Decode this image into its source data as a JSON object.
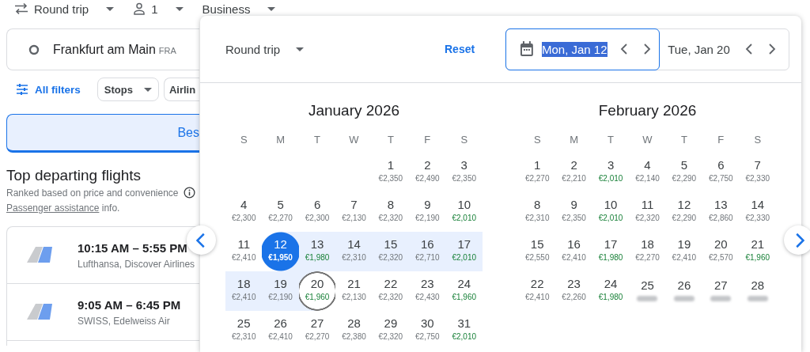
{
  "top_bar": {
    "trip_type": "Round trip",
    "passengers": "1",
    "cabin": "Business"
  },
  "search": {
    "origin": "Frankfurt am Main",
    "origin_code": "FRA"
  },
  "filters": {
    "all_filters": "All filters",
    "chips": [
      {
        "label": "Stops",
        "dropdown": true
      },
      {
        "label": "Airlin",
        "dropdown": false
      }
    ]
  },
  "sort_tab": {
    "label": "Bes",
    "selected": true
  },
  "results": {
    "title": "Top departing flights",
    "subtitle": "Ranked based on price and convenience",
    "link": "Passenger assistance",
    "link_suffix": " info."
  },
  "flights": [
    {
      "times": "10:15 AM – 5:55 PM",
      "airlines": "Lufthansa, Discover Airlines"
    },
    {
      "times": "9:05 AM – 6:45 PM",
      "airlines": "SWISS, Edelweiss Air"
    }
  ],
  "date_picker": {
    "trip_type": "Round trip",
    "reset": "Reset",
    "departure": {
      "value": "Mon, Jan 12",
      "focused": true,
      "text_selected": true
    },
    "return": {
      "value": "Tue, Jan 20",
      "focused": false,
      "text_selected": false
    },
    "months": [
      {
        "title": "January 2026",
        "weekdays": [
          "S",
          "M",
          "T",
          "W",
          "T",
          "F",
          "S"
        ],
        "weeks": [
          {
            "days": [
              {
                "kind": "blank"
              },
              {
                "kind": "blank"
              },
              {
                "kind": "blank"
              },
              {
                "kind": "blank"
              },
              {
                "kind": "day",
                "day": "1",
                "price": "€2,350",
                "low": false,
                "in_range": false
              },
              {
                "kind": "day",
                "day": "2",
                "price": "€2,490",
                "low": false,
                "in_range": false
              },
              {
                "kind": "day",
                "day": "3",
                "price": "€2,350",
                "low": false,
                "in_range": false
              }
            ]
          },
          {
            "days": [
              {
                "kind": "day",
                "day": "4",
                "price": "€2,300",
                "low": false,
                "in_range": false
              },
              {
                "kind": "day",
                "day": "5",
                "price": "€2,270",
                "low": false,
                "in_range": false
              },
              {
                "kind": "day",
                "day": "6",
                "price": "€2,300",
                "low": false,
                "in_range": false
              },
              {
                "kind": "day",
                "day": "7",
                "price": "€2,130",
                "low": false,
                "in_range": false
              },
              {
                "kind": "day",
                "day": "8",
                "price": "€2,320",
                "low": false,
                "in_range": false
              },
              {
                "kind": "day",
                "day": "9",
                "price": "€2,190",
                "low": false,
                "in_range": false
              },
              {
                "kind": "day",
                "day": "10",
                "price": "€2,010",
                "low": true,
                "in_range": false
              }
            ]
          },
          {
            "days": [
              {
                "kind": "day",
                "day": "11",
                "price": "€2,410",
                "low": false,
                "in_range": false
              },
              {
                "kind": "departure",
                "day": "12",
                "price": "€1,950"
              },
              {
                "kind": "day",
                "day": "13",
                "price": "€1,980",
                "low": true,
                "in_range": true
              },
              {
                "kind": "day",
                "day": "14",
                "price": "€2,310",
                "low": false,
                "in_range": true
              },
              {
                "kind": "day",
                "day": "15",
                "price": "€2,320",
                "low": false,
                "in_range": true
              },
              {
                "kind": "day",
                "day": "16",
                "price": "€2,710",
                "low": false,
                "in_range": true
              },
              {
                "kind": "day",
                "day": "17",
                "price": "€2,010",
                "low": true,
                "in_range": true
              }
            ]
          },
          {
            "days": [
              {
                "kind": "day",
                "day": "18",
                "price": "€2,410",
                "low": false,
                "in_range": true
              },
              {
                "kind": "day",
                "day": "19",
                "price": "€2,190",
                "low": false,
                "in_range": true
              },
              {
                "kind": "return",
                "day": "20",
                "price": "€1,960",
                "low": true
              },
              {
                "kind": "day",
                "day": "21",
                "price": "€2,130",
                "low": false,
                "in_range": false
              },
              {
                "kind": "day",
                "day": "22",
                "price": "€2,320",
                "low": false,
                "in_range": false
              },
              {
                "kind": "day",
                "day": "23",
                "price": "€2,430",
                "low": false,
                "in_range": false
              },
              {
                "kind": "day",
                "day": "24",
                "price": "€1,960",
                "low": true,
                "in_range": false
              }
            ]
          },
          {
            "days": [
              {
                "kind": "day",
                "day": "25",
                "price": "€2,310",
                "low": false,
                "in_range": false
              },
              {
                "kind": "day",
                "day": "26",
                "price": "€2,410",
                "low": false,
                "in_range": false
              },
              {
                "kind": "day",
                "day": "27",
                "price": "€2,270",
                "low": false,
                "in_range": false
              },
              {
                "kind": "day",
                "day": "28",
                "price": "€2,380",
                "low": false,
                "in_range": false
              },
              {
                "kind": "day",
                "day": "29",
                "price": "€2,320",
                "low": false,
                "in_range": false
              },
              {
                "kind": "day",
                "day": "30",
                "price": "€2,750",
                "low": false,
                "in_range": false
              },
              {
                "kind": "day",
                "day": "31",
                "price": "€2,010",
                "low": true,
                "in_range": false
              }
            ]
          }
        ]
      },
      {
        "title": "February 2026",
        "weekdays": [
          "S",
          "M",
          "T",
          "W",
          "T",
          "F",
          "S"
        ],
        "weeks": [
          {
            "days": [
              {
                "kind": "day",
                "day": "1",
                "price": "€2,270",
                "low": false,
                "in_range": false
              },
              {
                "kind": "day",
                "day": "2",
                "price": "€2,210",
                "low": false,
                "in_range": false
              },
              {
                "kind": "day",
                "day": "3",
                "price": "€2,010",
                "low": true,
                "in_range": false
              },
              {
                "kind": "day",
                "day": "4",
                "price": "€2,140",
                "low": false,
                "in_range": false
              },
              {
                "kind": "day",
                "day": "5",
                "price": "€2,290",
                "low": false,
                "in_range": false
              },
              {
                "kind": "day",
                "day": "6",
                "price": "€2,750",
                "low": false,
                "in_range": false
              },
              {
                "kind": "day",
                "day": "7",
                "price": "€2,330",
                "low": false,
                "in_range": false
              }
            ]
          },
          {
            "days": [
              {
                "kind": "day",
                "day": "8",
                "price": "€2,310",
                "low": false,
                "in_range": false
              },
              {
                "kind": "day",
                "day": "9",
                "price": "€2,350",
                "low": false,
                "in_range": false
              },
              {
                "kind": "day",
                "day": "10",
                "price": "€2,010",
                "low": true,
                "in_range": false
              },
              {
                "kind": "day",
                "day": "11",
                "price": "€2,320",
                "low": false,
                "in_range": false
              },
              {
                "kind": "day",
                "day": "12",
                "price": "€2,290",
                "low": false,
                "in_range": false
              },
              {
                "kind": "day",
                "day": "13",
                "price": "€2,860",
                "low": false,
                "in_range": false
              },
              {
                "kind": "day",
                "day": "14",
                "price": "€2,330",
                "low": false,
                "in_range": false
              }
            ]
          },
          {
            "days": [
              {
                "kind": "day",
                "day": "15",
                "price": "€2,550",
                "low": false,
                "in_range": false
              },
              {
                "kind": "day",
                "day": "16",
                "price": "€2,410",
                "low": false,
                "in_range": false
              },
              {
                "kind": "day",
                "day": "17",
                "price": "€1,980",
                "low": true,
                "in_range": false
              },
              {
                "kind": "day",
                "day": "18",
                "price": "€2,270",
                "low": false,
                "in_range": false
              },
              {
                "kind": "day",
                "day": "19",
                "price": "€2,410",
                "low": false,
                "in_range": false
              },
              {
                "kind": "day",
                "day": "20",
                "price": "€2,570",
                "low": false,
                "in_range": false
              },
              {
                "kind": "day",
                "day": "21",
                "price": "€1,960",
                "low": true,
                "in_range": false
              }
            ]
          },
          {
            "days": [
              {
                "kind": "day",
                "day": "22",
                "price": "€2,410",
                "low": false,
                "in_range": false
              },
              {
                "kind": "day",
                "day": "23",
                "price": "€2,260",
                "low": false,
                "in_range": false
              },
              {
                "kind": "day",
                "day": "24",
                "price": "€1,980",
                "low": true,
                "in_range": false
              },
              {
                "kind": "blurred",
                "day": "25",
                "in_range": false
              },
              {
                "kind": "blurred",
                "day": "26",
                "in_range": false
              },
              {
                "kind": "blurred",
                "day": "27",
                "in_range": false
              },
              {
                "kind": "blurred",
                "day": "28",
                "in_range": false
              }
            ]
          }
        ]
      }
    ]
  }
}
